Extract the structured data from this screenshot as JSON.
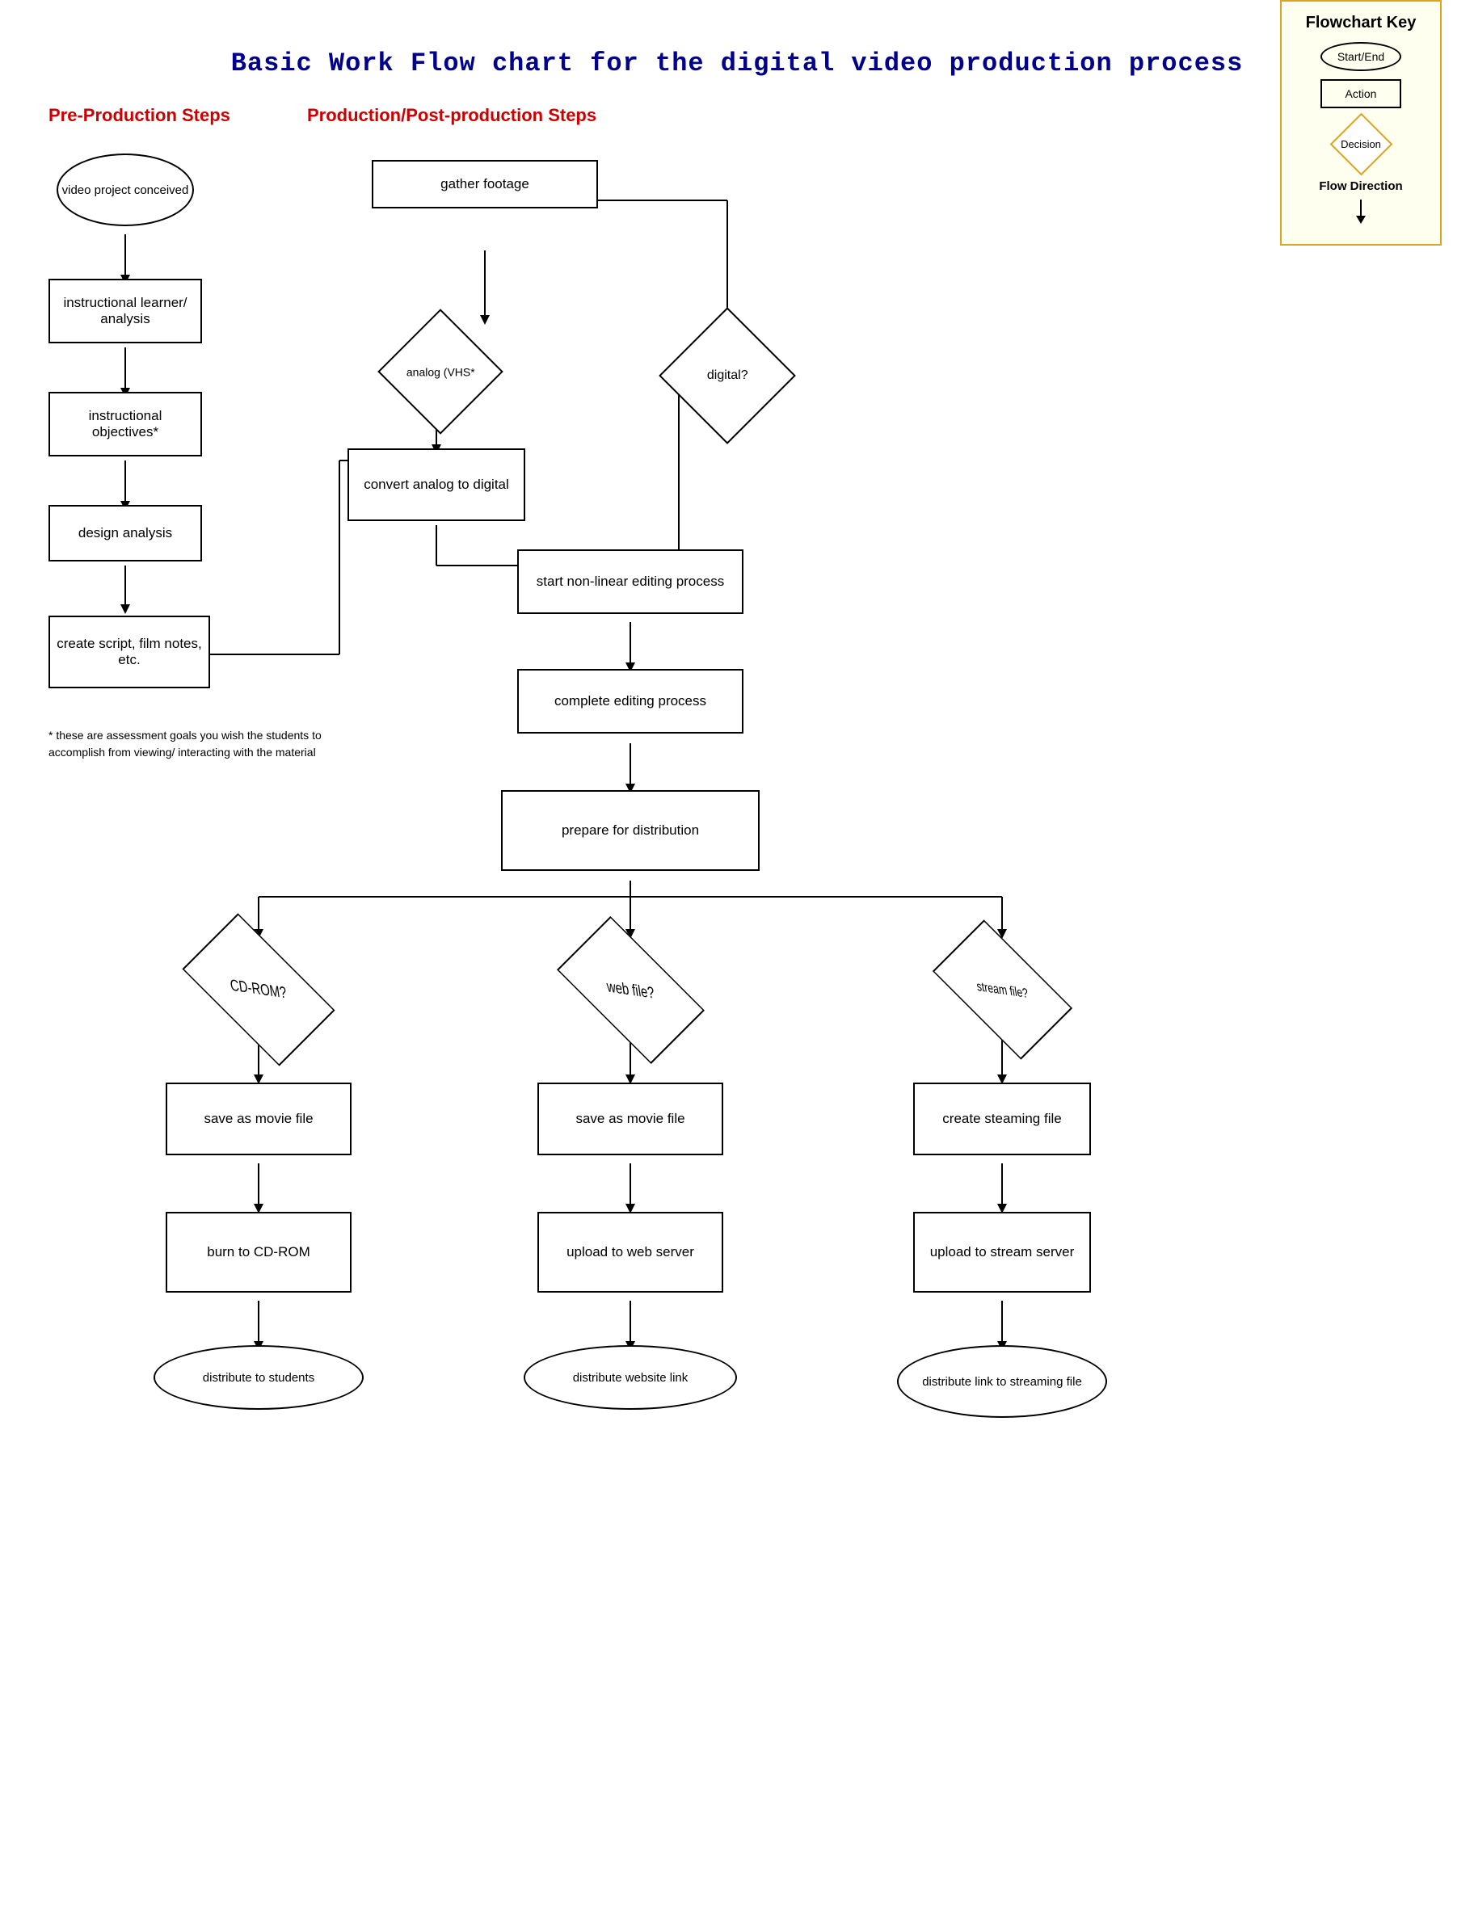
{
  "title": "Basic Work Flow chart for the digital video production process",
  "sections": {
    "preProduction": {
      "label": "Pre-Production Steps",
      "nodes": [
        {
          "id": "video_project",
          "shape": "oval",
          "text": "video project conceived"
        },
        {
          "id": "instructional_learner",
          "shape": "wavy",
          "text": "instructional learner/ analysis"
        },
        {
          "id": "instructional_objectives",
          "shape": "wavy",
          "text": "instructional objectives*"
        },
        {
          "id": "design_analysis",
          "shape": "rect",
          "text": "design analysis"
        },
        {
          "id": "create_script",
          "shape": "rect",
          "text": "create script, film notes, etc."
        }
      ]
    },
    "production": {
      "label": "Production/Post-production Steps",
      "nodes": [
        {
          "id": "gather_footage",
          "shape": "rect",
          "text": "gather footage"
        },
        {
          "id": "analog_vhs",
          "shape": "diamond",
          "text": "analog (VHS*"
        },
        {
          "id": "digital",
          "shape": "diamond",
          "text": "digital?"
        },
        {
          "id": "convert_analog",
          "shape": "rect",
          "text": "convert analog to digital"
        },
        {
          "id": "start_nonlinear",
          "shape": "rect",
          "text": "start non-linear editing process"
        },
        {
          "id": "complete_editing",
          "shape": "rect",
          "text": "complete editing process"
        },
        {
          "id": "prepare_distribution",
          "shape": "rect",
          "text": "prepare for distribution"
        }
      ]
    },
    "distribution": {
      "branches": [
        {
          "id": "cdrom_branch",
          "nodes": [
            {
              "id": "cdrom_q",
              "shape": "diamond",
              "text": "CD-ROM?"
            },
            {
              "id": "save_movie_cdrom",
              "shape": "rect",
              "text": "save as movie file"
            },
            {
              "id": "burn_cdrom",
              "shape": "rect",
              "text": "burn to CD-ROM"
            },
            {
              "id": "distribute_students",
              "shape": "oval",
              "text": "distribute to students"
            }
          ]
        },
        {
          "id": "web_branch",
          "nodes": [
            {
              "id": "web_q",
              "shape": "diamond",
              "text": "web file?"
            },
            {
              "id": "save_movie_web",
              "shape": "rect",
              "text": "save as movie file"
            },
            {
              "id": "upload_web",
              "shape": "rect",
              "text": "upload to web server"
            },
            {
              "id": "distribute_website",
              "shape": "oval",
              "text": "distribute website link"
            }
          ]
        },
        {
          "id": "stream_branch",
          "nodes": [
            {
              "id": "stream_q",
              "shape": "diamond",
              "text": "stream file?"
            },
            {
              "id": "create_streaming",
              "shape": "rect",
              "text": "create steaming file"
            },
            {
              "id": "upload_stream",
              "shape": "rect",
              "text": "upload to stream server"
            },
            {
              "id": "distribute_link",
              "shape": "oval",
              "text": "distribute link to streaming file"
            }
          ]
        }
      ]
    }
  },
  "key": {
    "title": "Flowchart Key",
    "items": [
      {
        "label": "Start/End",
        "shape": "oval"
      },
      {
        "label": "Action",
        "shape": "rect"
      },
      {
        "label": "Decision",
        "shape": "diamond"
      },
      {
        "label": "Flow Direction",
        "type": "arrow"
      }
    ]
  },
  "footnote": "* these are assessment goals you wish the students to accomplish from viewing/ interacting with the material"
}
